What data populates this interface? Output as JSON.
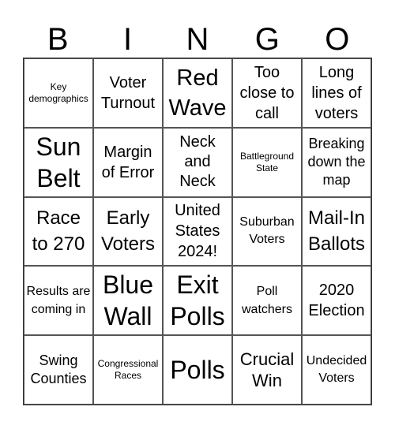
{
  "header": [
    "B",
    "I",
    "N",
    "G",
    "O"
  ],
  "cells": [
    "Key demographics",
    "Voter Turnout",
    "Red Wave",
    "Too close to call",
    "Long lines of voters",
    "Sun Belt",
    "Margin of Error",
    "Neck and Neck",
    "Battleground State",
    "Breaking down the map",
    "Race to 270",
    "Early Voters",
    "United States 2024!",
    "Suburban Voters",
    "Mail-In Ballots",
    "Results are coming in",
    "Blue Wall",
    "Exit Polls",
    "Poll watchers",
    "2020 Election",
    "Swing Counties",
    "Congressional Races",
    "Polls",
    "Crucial Win",
    "Undecided Voters"
  ]
}
